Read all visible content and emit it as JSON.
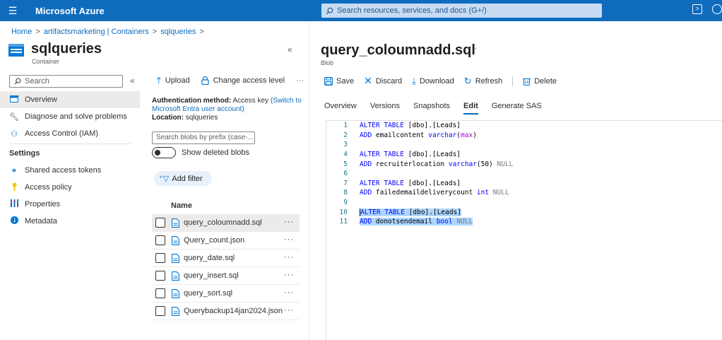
{
  "topbar": {
    "brand": "Microsoft Azure",
    "search_placeholder": "Search resources, services, and docs (G+/)",
    "bg_color": "#0f6cbd"
  },
  "breadcrumb": [
    "Home",
    "artifactsmarketing | Containers",
    "sqlqueries"
  ],
  "resource": {
    "title": "sqlqueries",
    "subtitle": "Container"
  },
  "left_nav": {
    "search_placeholder": "Search",
    "items": [
      {
        "label": "Overview",
        "icon": "overview-icon"
      },
      {
        "label": "Diagnose and solve problems",
        "icon": "wrench-icon"
      },
      {
        "label": "Access Control (IAM)",
        "icon": "people-icon"
      }
    ],
    "settings_heading": "Settings",
    "settings_items": [
      {
        "label": "Shared access tokens",
        "icon": "link-icon"
      },
      {
        "label": "Access policy",
        "icon": "key-icon"
      },
      {
        "label": "Properties",
        "icon": "properties-icon"
      },
      {
        "label": "Metadata",
        "icon": "info-icon"
      }
    ]
  },
  "container_panel": {
    "upload_label": "Upload",
    "change_access_label": "Change access level",
    "more_label": "···",
    "auth_label": "Authentication method:",
    "auth_value": "Access key",
    "auth_link": "(Switch to Microsoft Entra user account)",
    "location_label": "Location:",
    "location_value": "sqlqueries",
    "blob_search_placeholder": "Search blobs by prefix (case-...",
    "show_deleted_label": "Show deleted blobs",
    "add_filter_label": "Add filter",
    "name_header": "Name",
    "files": [
      "query_coloumnadd.sql",
      "Query_count.json",
      "query_date.sql",
      "query_insert.sql",
      "query_sort.sql",
      "Querybackup14jan2024.json"
    ],
    "row_more": "···"
  },
  "blob": {
    "title": "query_coloumnadd.sql",
    "more": "···",
    "subtitle": "Blob",
    "toolbar": {
      "save": "Save",
      "discard": "Discard",
      "download": "Download",
      "refresh": "Refresh",
      "delete": "Delete"
    },
    "tabs": [
      "Overview",
      "Versions",
      "Snapshots",
      "Edit",
      "Generate SAS"
    ],
    "active_tab": "Edit"
  },
  "editor": {
    "lines": [
      {
        "n": "1",
        "text": "ALTER TABLE [dbo].[Leads]"
      },
      {
        "n": "2",
        "text": "ADD emailcontent varchar(max)"
      },
      {
        "n": "3",
        "text": ""
      },
      {
        "n": "4",
        "text": "ALTER TABLE [dbo].[Leads]"
      },
      {
        "n": "5",
        "text": "ADD recruiterlocation varchar(50) NULL"
      },
      {
        "n": "6",
        "text": ""
      },
      {
        "n": "7",
        "text": "ALTER TABLE [dbo].[Leads]"
      },
      {
        "n": "8",
        "text": "ADD failedemaildeliverycount int NULL"
      },
      {
        "n": "9",
        "text": ""
      },
      {
        "n": "10",
        "text": "ALTER TABLE [dbo].[Leads]"
      },
      {
        "n": "11",
        "text": "ADD donotsendemail bool NULL"
      }
    ]
  }
}
